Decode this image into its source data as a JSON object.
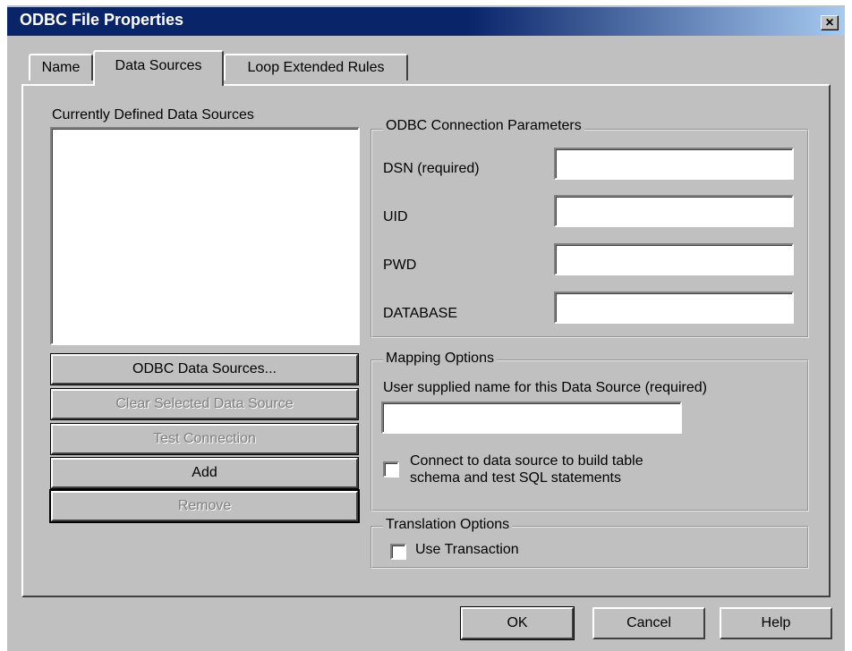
{
  "window": {
    "title": "ODBC File Properties",
    "close_glyph": "×"
  },
  "tabs": [
    {
      "label": "Name",
      "active": false
    },
    {
      "label": "Data Sources",
      "active": true
    },
    {
      "label": "Loop Extended Rules",
      "active": false
    }
  ],
  "data_sources": {
    "list_label": "Currently Defined Data Sources",
    "items": [],
    "buttons": {
      "odbc_data_sources": "ODBC Data Sources...",
      "clear_selected": "Clear Selected Data Source",
      "test_connection": "Test Connection",
      "add": "Add",
      "remove": "Remove"
    }
  },
  "connection_params": {
    "legend": "ODBC Connection Parameters",
    "dsn_label": "DSN (required)",
    "dsn_value": "",
    "uid_label": "UID",
    "uid_value": "",
    "pwd_label": "PWD",
    "pwd_value": "",
    "database_label": "DATABASE",
    "database_value": ""
  },
  "mapping_options": {
    "legend": "Mapping Options",
    "name_label": "User supplied name for this Data Source (required)",
    "name_value": "",
    "connect_line1": "Connect to data source to build table",
    "connect_line2": "schema and test SQL statements",
    "connect_checked": false
  },
  "translation_options": {
    "legend": "Translation Options",
    "use_transaction_label": "Use Transaction",
    "use_transaction_checked": false
  },
  "footer": {
    "ok": "OK",
    "cancel": "Cancel",
    "help": "Help"
  }
}
